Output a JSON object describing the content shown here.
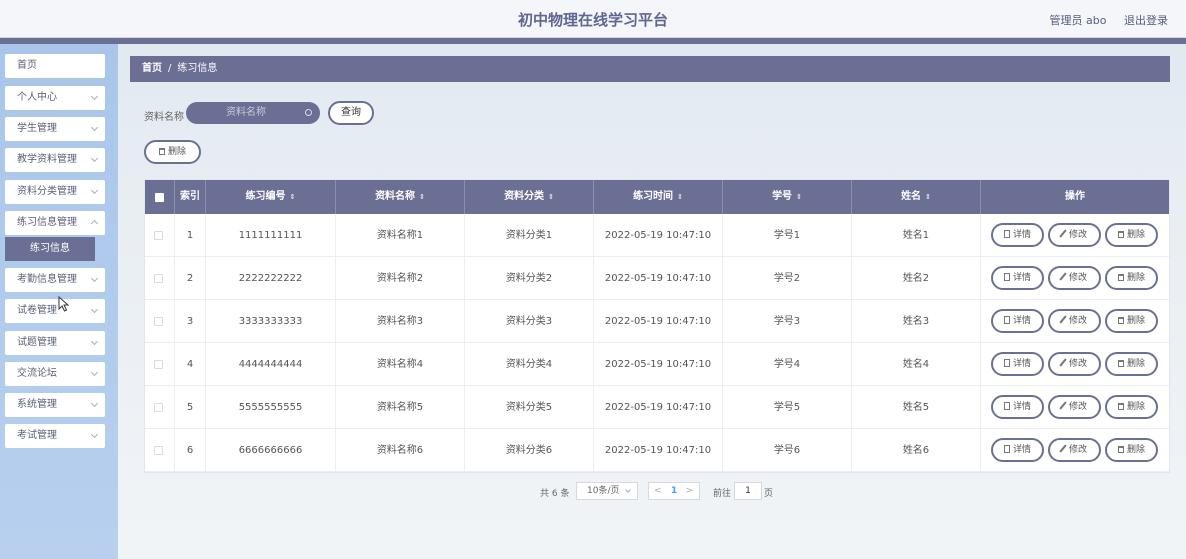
{
  "header": {
    "title": "初中物理在线学习平台",
    "user": "管理员 abo",
    "logout": "退出登录"
  },
  "sidebar": {
    "items": [
      {
        "label": "首页"
      },
      {
        "label": "个人中心"
      },
      {
        "label": "学生管理"
      },
      {
        "label": "教学资料管理"
      },
      {
        "label": "资料分类管理"
      },
      {
        "label": "练习信息管理"
      },
      {
        "label": "考勤信息管理"
      },
      {
        "label": "试卷管理"
      },
      {
        "label": "试题管理"
      },
      {
        "label": "交流论坛"
      },
      {
        "label": "系统管理"
      },
      {
        "label": "考试管理"
      }
    ],
    "active_sub": "练习信息"
  },
  "breadcrumb": {
    "home": "首页",
    "separator": "/",
    "current": "练习信息"
  },
  "search": {
    "label": "资料名称",
    "placeholder": "资料名称",
    "query_button": "查询"
  },
  "batch_delete": "删除",
  "table": {
    "columns": [
      "索引",
      "练习编号",
      "资料名称",
      "资料分类",
      "练习时间",
      "学号",
      "姓名",
      "操作"
    ],
    "sort_icon": "⇕",
    "rows": [
      {
        "index": "1",
        "code": "1111111111",
        "name": "资料名称1",
        "category": "资料分类1",
        "time": "2022-05-19 10:47:10",
        "student_id": "学号1",
        "student_name": "姓名1"
      },
      {
        "index": "2",
        "code": "2222222222",
        "name": "资料名称2",
        "category": "资料分类2",
        "time": "2022-05-19 10:47:10",
        "student_id": "学号2",
        "student_name": "姓名2"
      },
      {
        "index": "3",
        "code": "3333333333",
        "name": "资料名称3",
        "category": "资料分类3",
        "time": "2022-05-19 10:47:10",
        "student_id": "学号3",
        "student_name": "姓名3"
      },
      {
        "index": "4",
        "code": "4444444444",
        "name": "资料名称4",
        "category": "资料分类4",
        "time": "2022-05-19 10:47:10",
        "student_id": "学号4",
        "student_name": "姓名4"
      },
      {
        "index": "5",
        "code": "5555555555",
        "name": "资料名称5",
        "category": "资料分类5",
        "time": "2022-05-19 10:47:10",
        "student_id": "学号5",
        "student_name": "姓名5"
      },
      {
        "index": "6",
        "code": "6666666666",
        "name": "资料名称6",
        "category": "资料分类6",
        "time": "2022-05-19 10:47:10",
        "student_id": "学号6",
        "student_name": "姓名6"
      }
    ],
    "actions": {
      "detail": "详情",
      "edit": "修改",
      "delete": "删除"
    }
  },
  "pagination": {
    "total": "共 6 条",
    "page_size": "10条/页",
    "prev": "<",
    "current_page": "1",
    "next": ">",
    "goto_label": "前往",
    "goto_value": "1",
    "page_suffix": "页"
  },
  "colors": {
    "primary": "#6b6f94",
    "sidebar": "#a9c6ea",
    "link": "#409eff"
  }
}
